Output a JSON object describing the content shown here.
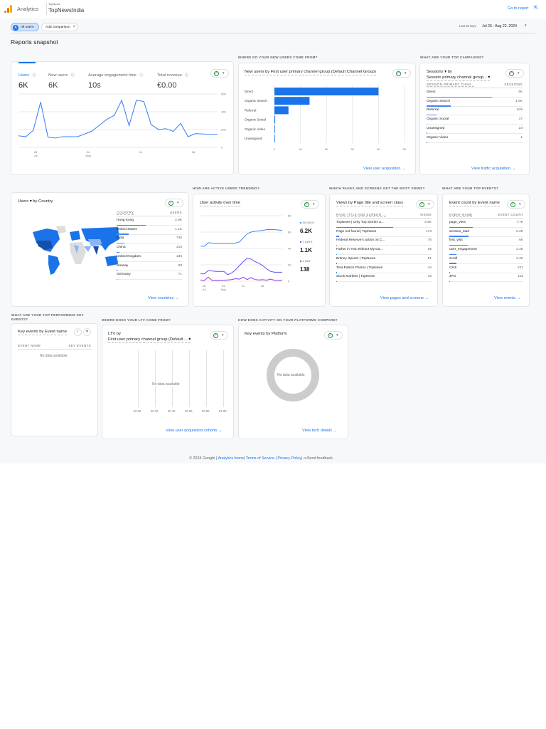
{
  "header": {
    "app": "Analytics",
    "account": "TopNews",
    "property": "TopNewsIndia",
    "go_to_report": "Go to report"
  },
  "toolbar": {
    "segment_initial": "A",
    "segment": "All users",
    "add_comparison": "Add comparison",
    "range_label": "Last 28 days",
    "range": "Jul 26 - Aug 22, 2024"
  },
  "page_title": "Reports snapshot",
  "overview": {
    "metrics": [
      {
        "label": "Users",
        "value": "6K"
      },
      {
        "label": "New users",
        "value": "6K"
      },
      {
        "label": "Average engagement time",
        "value": "10s"
      },
      {
        "label": "Total revenue",
        "value": "€0.00"
      }
    ],
    "y_ticks": [
      "600",
      "400",
      "200",
      "0"
    ],
    "x_ticks": [
      {
        "d": "28",
        "m": "Jul"
      },
      {
        "d": "04",
        "m": "Aug"
      },
      {
        "d": "11",
        "m": ""
      },
      {
        "d": "18",
        "m": ""
      }
    ]
  },
  "new_users": {
    "question": "Where do your new users come from?",
    "title": "New users by First user primary channel group (Default Channel Group)",
    "link": "View user acquisition",
    "x_ticks": [
      "0",
      "1K",
      "2K",
      "3K",
      "4K",
      "5K"
    ]
  },
  "campaigns": {
    "question": "What are your top campaigns?",
    "title_1": "Sessions",
    "title_2": "by",
    "title_3": "Session primary channel group...",
    "col1": "Session primary chan...",
    "col2": "Sessions",
    "link": "View traffic acquisition",
    "rows": [
      {
        "name": "Direct",
        "value": "4K",
        "share": 0.68
      },
      {
        "name": "Organic Search",
        "value": "1.5K",
        "share": 0.25
      },
      {
        "name": "Referral",
        "value": "549",
        "share": 0.1
      },
      {
        "name": "Organic Social",
        "value": "37",
        "share": 0.01
      },
      {
        "name": "Unassigned",
        "value": "23",
        "share": 0.01
      },
      {
        "name": "Organic Video",
        "value": "1",
        "share": 0
      }
    ]
  },
  "country": {
    "title_1": "Users",
    "title_2": "by Country",
    "col1": "Country",
    "col2": "Users",
    "link": "View countries",
    "rows": [
      {
        "name": "Hong Kong",
        "value": "2.9K",
        "share": 0.45
      },
      {
        "name": "United States",
        "value": "1.1K",
        "share": 0.18
      },
      {
        "name": "India",
        "value": "746",
        "share": 0.12
      },
      {
        "name": "China",
        "value": "215",
        "share": 0.04
      },
      {
        "name": "United Kingdom",
        "value": "136",
        "share": 0.02
      },
      {
        "name": "Norway",
        "value": "80",
        "share": 0.01
      },
      {
        "name": "Germany",
        "value": "71",
        "share": 0.01
      }
    ]
  },
  "activity": {
    "question": "How are active users trending?",
    "title": "User activity over time",
    "y_ticks": [
      "8K",
      "6K",
      "4K",
      "2K",
      "0"
    ],
    "x_ticks": [
      {
        "d": "28",
        "m": "Jul"
      },
      {
        "d": "04",
        "m": "Aug"
      },
      {
        "d": "11",
        "m": ""
      },
      {
        "d": "18",
        "m": ""
      }
    ],
    "legend": [
      {
        "label": "30 DAYS",
        "value": "6.2K",
        "color": "#4285f4"
      },
      {
        "label": "7 DAYS",
        "value": "1.1K",
        "color": "#5b4ff5"
      },
      {
        "label": "1 DAY",
        "value": "138",
        "color": "#9334e6"
      }
    ]
  },
  "pages": {
    "question": "Which pages and screens get the most views?",
    "title": "Views by Page title and screen class",
    "col1": "Page title and screen ...",
    "col2": "Views",
    "link": "View pages and screens",
    "rows": [
      {
        "name": "TopNews | Only Top Stories a...",
        "value": "4.5K",
        "share": 0.6
      },
      {
        "name": "Page not found | TopNews",
        "value": "173",
        "share": 0.03
      },
      {
        "name": "Federal Reserve's action on C...",
        "value": "76",
        "share": 0.01
      },
      {
        "name": "Father in 'Not Without My Da...",
        "value": "69",
        "share": 0.01
      },
      {
        "name": "Britney Spears | TopNews",
        "value": "51",
        "share": 0.01
      },
      {
        "name": "Tera Patrick Photos | TopNews",
        "value": "44",
        "share": 0.01
      },
      {
        "name": "Stock Markets | TopNews",
        "value": "33",
        "share": 0.01
      }
    ]
  },
  "events": {
    "question": "What are your top events?",
    "title": "Event count by Event name",
    "col1": "Event name",
    "col2": "Event count",
    "link": "View events",
    "rows": [
      {
        "name": "page_view",
        "value": "7.7K",
        "share": 0.32
      },
      {
        "name": "session_start",
        "value": "6.2K",
        "share": 0.26
      },
      {
        "name": "first_visit",
        "value": "6K",
        "share": 0.25
      },
      {
        "name": "user_engagement",
        "value": "2.4K",
        "share": 0.1
      },
      {
        "name": "scroll",
        "value": "2.4K",
        "share": 0.1
      },
      {
        "name": "Click",
        "value": "227",
        "share": 0.01
      },
      {
        "name": "JPG",
        "value": "115",
        "share": 0.01
      }
    ]
  },
  "key_events": {
    "question": "What are your top performing key events?",
    "title": "Key events by Event name",
    "col1": "Event name",
    "col2": "Key events",
    "empty": "No data available"
  },
  "ltv": {
    "question": "Where does your LTV come from?",
    "title_1": "LTV by",
    "title_2": "First user primary channel group (Default ...",
    "empty": "No data available",
    "x_ticks": [
      "€0.00",
      "€0.20",
      "€0.40",
      "€0.60",
      "€0.80",
      "€1.00"
    ],
    "link": "View user acquisition cohorts"
  },
  "platform": {
    "question": "How does activity on your platforms compare?",
    "title": "Key events by Platform",
    "empty": "No data available",
    "link": "View tech details"
  },
  "footer": {
    "copyright": "© 2024 Google |",
    "home": "Analytics home",
    "tos": "Terms of Service",
    "privacy": "Privacy Policy",
    "feedback": "Send feedback",
    "sep": "|"
  },
  "chart_data": [
    {
      "type": "line",
      "title": "Users",
      "ylim": [
        0,
        600
      ],
      "series": [
        {
          "name": "Users",
          "values": [
            130,
            120,
            190,
            510,
            115,
            105,
            120,
            120,
            120,
            150,
            185,
            250,
            315,
            360,
            530,
            245,
            530,
            515,
            255,
            200,
            210,
            180,
            270,
            120,
            155,
            150,
            145,
            148
          ]
        }
      ]
    },
    {
      "type": "bar",
      "title": "New users by First user primary channel group",
      "categories": [
        "Direct",
        "Organic Search",
        "Referral",
        "Organic Social",
        "Organic Video",
        "Unassigned"
      ],
      "values": [
        4000,
        1350,
        540,
        30,
        5,
        20
      ],
      "xlim": [
        0,
        5000
      ]
    },
    {
      "type": "line",
      "title": "User activity over time",
      "ylim": [
        0,
        8000
      ],
      "series": [
        {
          "name": "30 DAYS",
          "values": [
            4300,
            4250,
            4700,
            4650,
            4600,
            4600,
            4650,
            4600,
            4600,
            4650,
            4800,
            5300,
            5800,
            6000,
            6100,
            6150,
            6200,
            6300,
            6300,
            6300,
            6250,
            6200
          ]
        },
        {
          "name": "7 DAYS",
          "values": [
            900,
            900,
            1300,
            1250,
            1200,
            1200,
            1200,
            800,
            1000,
            1400,
            1900,
            2400,
            2800,
            2700,
            2400,
            2200,
            1900,
            1500,
            1200,
            1100,
            1100,
            1100
          ]
        },
        {
          "name": "1 DAY",
          "values": [
            150,
            100,
            500,
            100,
            120,
            110,
            130,
            150,
            200,
            300,
            250,
            500,
            200,
            450,
            200,
            150,
            180,
            130,
            250,
            120,
            110,
            138
          ]
        }
      ]
    }
  ]
}
